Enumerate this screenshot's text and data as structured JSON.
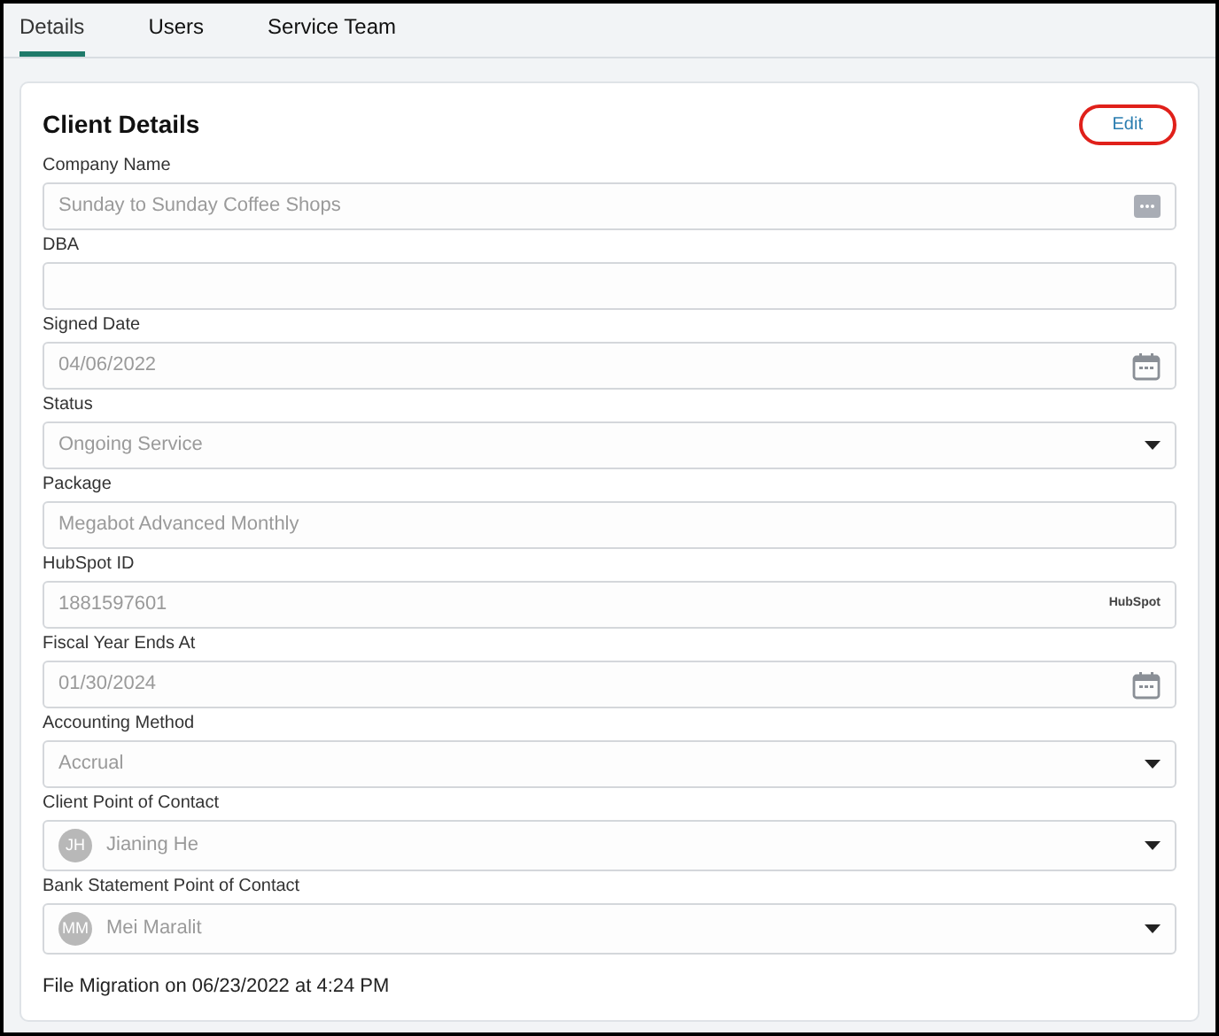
{
  "tabs": [
    {
      "label": "Details",
      "selected": true
    },
    {
      "label": "Users",
      "selected": false
    },
    {
      "label": "Service Team",
      "selected": false
    }
  ],
  "card": {
    "title": "Client Details",
    "edit_button": {
      "label": "Edit",
      "highlighted": true
    },
    "fields": [
      {
        "label": "Company Name",
        "kind": "menu",
        "value": "Sunday to Sunday Coffee Shops"
      },
      {
        "label": "DBA",
        "kind": "text"
      },
      {
        "label": "Signed Date",
        "kind": "date",
        "value": "04/06/2022"
      },
      {
        "label": "Status",
        "kind": "select",
        "value": "Ongoing Service"
      },
      {
        "label": "Package",
        "kind": "text",
        "value": "Megabot Advanced Monthly"
      },
      {
        "label": "HubSpot ID",
        "kind": "hubspot",
        "value": "1881597601",
        "badge": "HubSpot"
      },
      {
        "label": "Fiscal Year Ends At",
        "kind": "date",
        "value": "01/30/2024"
      },
      {
        "label": "Accounting Method",
        "kind": "select",
        "value": "Accrual"
      },
      {
        "label": "Client Point of Contact",
        "kind": "contact",
        "initials": "JH",
        "value": "Jianing He"
      },
      {
        "label": "Bank Statement Point of Contact",
        "kind": "contact",
        "initials": "MM",
        "value": "Mei Maralit"
      }
    ],
    "footer": "File Migration on 06/23/2022 at 4:24 PM"
  }
}
